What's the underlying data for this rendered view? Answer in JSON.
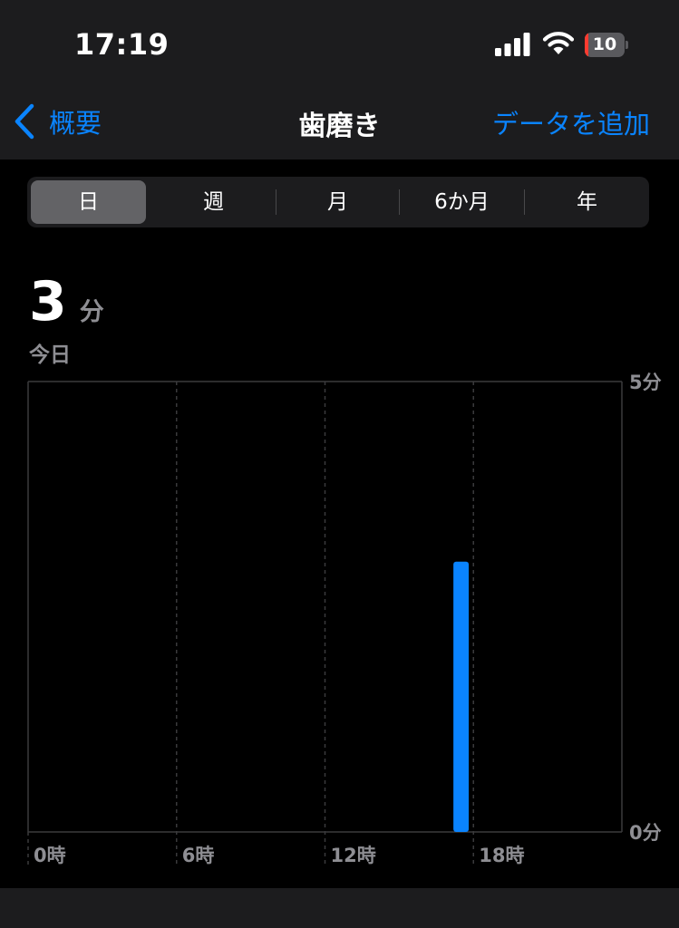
{
  "status": {
    "time": "17:19",
    "battery_level": "10",
    "battery_fraction": 0.1,
    "signal_icon": "cellular-signal-icon",
    "wifi_icon": "wifi-icon",
    "colors": {
      "battery_low": "#ff3b30"
    }
  },
  "nav": {
    "back_label": "概要",
    "title": "歯磨き",
    "add_label": "データを追加",
    "back_icon": "chevron-left-icon"
  },
  "range": {
    "tabs": [
      {
        "label": "日",
        "selected": true
      },
      {
        "label": "週",
        "selected": false
      },
      {
        "label": "月",
        "selected": false
      },
      {
        "label": "6か月",
        "selected": false
      },
      {
        "label": "年",
        "selected": false
      }
    ]
  },
  "summary": {
    "value": "3",
    "unit": "分",
    "date_label": "今日"
  },
  "chart_data": {
    "type": "bar",
    "x_ticks": [
      "0時",
      "6時",
      "12時",
      "18時"
    ],
    "y_ticks": [
      "0分",
      "5分"
    ],
    "ylim": [
      0,
      5
    ],
    "xlim_hours": [
      0,
      24
    ],
    "series": [
      {
        "values": [
          {
            "hour": 17,
            "minutes": 3
          }
        ]
      }
    ],
    "grid": true,
    "colors": {
      "bar": "#0a84ff",
      "grid": "#3a3a3c",
      "label": "#8e8e93"
    }
  }
}
